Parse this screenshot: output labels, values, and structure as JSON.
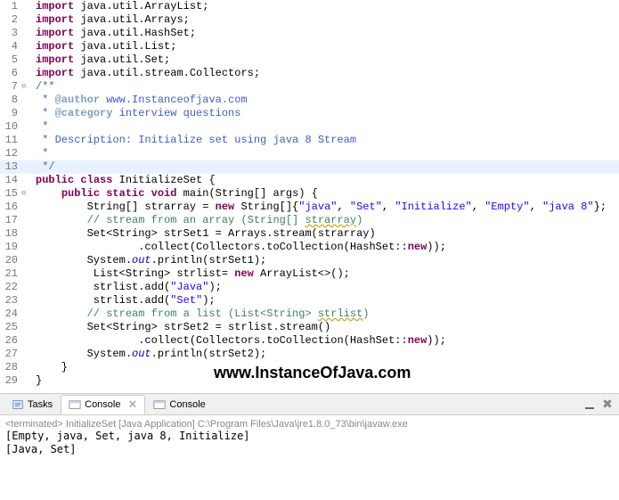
{
  "code": {
    "lines": [
      {
        "n": "1",
        "m": "",
        "seg": [
          [
            "kw",
            "import"
          ],
          [
            "",
            " java.util.ArrayList;"
          ]
        ]
      },
      {
        "n": "2",
        "m": "",
        "seg": [
          [
            "kw",
            "import"
          ],
          [
            "",
            " java.util.Arrays;"
          ]
        ]
      },
      {
        "n": "3",
        "m": "",
        "seg": [
          [
            "kw",
            "import"
          ],
          [
            "",
            " java.util.HashSet;"
          ]
        ]
      },
      {
        "n": "4",
        "m": "",
        "seg": [
          [
            "kw",
            "import"
          ],
          [
            "",
            " java.util.List;"
          ]
        ]
      },
      {
        "n": "5",
        "m": "",
        "seg": [
          [
            "kw",
            "import"
          ],
          [
            "",
            " java.util.Set;"
          ]
        ]
      },
      {
        "n": "6",
        "m": "",
        "seg": [
          [
            "kw",
            "import"
          ],
          [
            "",
            " java.util.stream.Collectors;"
          ]
        ]
      },
      {
        "n": "7",
        "m": "⊖",
        "seg": [
          [
            "doc",
            "/**"
          ]
        ]
      },
      {
        "n": "8",
        "m": "",
        "seg": [
          [
            "doc",
            " * "
          ],
          [
            "doctag",
            "@author"
          ],
          [
            "doc",
            " www.Instanceofjava.com"
          ]
        ]
      },
      {
        "n": "9",
        "m": "",
        "seg": [
          [
            "doc",
            " * "
          ],
          [
            "doctag",
            "@category"
          ],
          [
            "doc",
            " interview questions"
          ]
        ]
      },
      {
        "n": "10",
        "m": "",
        "seg": [
          [
            "doc",
            " *"
          ]
        ]
      },
      {
        "n": "11",
        "m": "",
        "seg": [
          [
            "doc",
            " * Description: Initialize set using java 8 Stream"
          ]
        ]
      },
      {
        "n": "12",
        "m": "",
        "seg": [
          [
            "doc",
            " *"
          ]
        ]
      },
      {
        "n": "13",
        "m": "",
        "hl": true,
        "seg": [
          [
            "doc",
            " */"
          ]
        ]
      },
      {
        "n": "14",
        "m": "",
        "seg": [
          [
            "kw",
            "public"
          ],
          [
            "",
            " "
          ],
          [
            "kw",
            "class"
          ],
          [
            "",
            " InitializeSet {"
          ]
        ]
      },
      {
        "n": "15",
        "m": "⊖",
        "seg": [
          [
            "",
            "    "
          ],
          [
            "kw",
            "public"
          ],
          [
            "",
            " "
          ],
          [
            "kw",
            "static"
          ],
          [
            "",
            " "
          ],
          [
            "kw",
            "void"
          ],
          [
            "",
            " main(String[] args) {"
          ]
        ]
      },
      {
        "n": "16",
        "m": "",
        "seg": [
          [
            "",
            "        String[] strarray = "
          ],
          [
            "kw",
            "new"
          ],
          [
            "",
            " String[]{"
          ],
          [
            "str",
            "\"java\""
          ],
          [
            "",
            ", "
          ],
          [
            "str",
            "\"Set\""
          ],
          [
            "",
            ", "
          ],
          [
            "str",
            "\"Initialize\""
          ],
          [
            "",
            ", "
          ],
          [
            "str",
            "\"Empty\""
          ],
          [
            "",
            ", "
          ],
          [
            "str",
            "\"java 8\""
          ],
          [
            "",
            "};"
          ]
        ]
      },
      {
        "n": "17",
        "m": "",
        "seg": [
          [
            "",
            "        "
          ],
          [
            "com",
            "// stream from an array (String[] "
          ],
          [
            "com err",
            "strarray"
          ],
          [
            "com",
            ")"
          ]
        ]
      },
      {
        "n": "18",
        "m": "",
        "seg": [
          [
            "",
            "        Set<String> strSet1 = Arrays."
          ],
          [
            "",
            "stream"
          ],
          [
            "",
            "(strarray)"
          ]
        ]
      },
      {
        "n": "19",
        "m": "",
        "seg": [
          [
            "",
            "                .collect(Collectors."
          ],
          [
            "",
            "toCollection"
          ],
          [
            "",
            "(HashSet::"
          ],
          [
            "kw",
            "new"
          ],
          [
            "",
            "));"
          ]
        ]
      },
      {
        "n": "20",
        "m": "",
        "seg": [
          [
            "",
            "        System."
          ],
          [
            "field",
            "out"
          ],
          [
            "",
            ".println(strSet1);"
          ]
        ]
      },
      {
        "n": "21",
        "m": "",
        "seg": [
          [
            "",
            "         List<String> strlist= "
          ],
          [
            "kw",
            "new"
          ],
          [
            "",
            " ArrayList<>();"
          ]
        ]
      },
      {
        "n": "22",
        "m": "",
        "seg": [
          [
            "",
            "         strlist.add("
          ],
          [
            "str",
            "\"Java\""
          ],
          [
            "",
            ");"
          ]
        ]
      },
      {
        "n": "23",
        "m": "",
        "seg": [
          [
            "",
            "         strlist.add("
          ],
          [
            "str",
            "\"Set\""
          ],
          [
            "",
            ");"
          ]
        ]
      },
      {
        "n": "24",
        "m": "",
        "seg": [
          [
            "",
            "        "
          ],
          [
            "com",
            "// stream from a list (List<String> "
          ],
          [
            "com err",
            "strlist"
          ],
          [
            "com",
            ")"
          ]
        ]
      },
      {
        "n": "25",
        "m": "",
        "seg": [
          [
            "",
            "        Set<String> strSet2 = strlist.stream()"
          ]
        ]
      },
      {
        "n": "26",
        "m": "",
        "seg": [
          [
            "",
            "                .collect(Collectors."
          ],
          [
            "",
            "toCollection"
          ],
          [
            "",
            "(HashSet::"
          ],
          [
            "kw",
            "new"
          ],
          [
            "",
            "));"
          ]
        ]
      },
      {
        "n": "27",
        "m": "",
        "seg": [
          [
            "",
            "        System."
          ],
          [
            "field",
            "out"
          ],
          [
            "",
            ".println(strSet2);"
          ]
        ]
      },
      {
        "n": "28",
        "m": "",
        "seg": [
          [
            "",
            "    }"
          ]
        ]
      },
      {
        "n": "29",
        "m": "",
        "seg": [
          [
            "",
            "}"
          ]
        ]
      }
    ]
  },
  "watermark": "www.InstanceOfJava.com",
  "tabs": {
    "tasks": "Tasks",
    "console_active": "Console",
    "console_inactive": "Console"
  },
  "console": {
    "terminated": "<terminated> InitializeSet [Java Application] C:\\Program Files\\Java\\jre1.8.0_73\\bin\\javaw.exe",
    "out1": "[Empty, java, Set, java 8, Initialize]",
    "out2": "[Java, Set]"
  }
}
